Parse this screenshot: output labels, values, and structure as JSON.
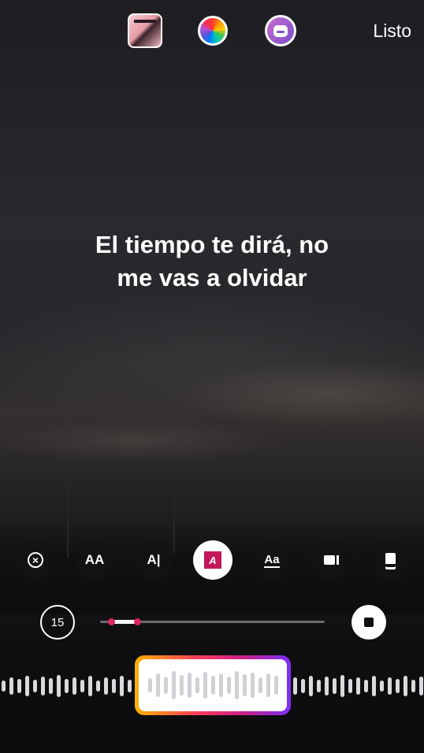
{
  "topbar": {
    "done_label": "Listo"
  },
  "lyrics": {
    "line1": "El tiempo te dirá, no",
    "line2": "me vas a olvidar"
  },
  "tools": [
    {
      "name": "close-style-button",
      "glyph": "⊗"
    },
    {
      "name": "text-size-button",
      "glyph": "AA"
    },
    {
      "name": "text-align-button",
      "glyph": "A|"
    },
    {
      "name": "highlight-style-button",
      "glyph": "A"
    },
    {
      "name": "underline-style-button",
      "glyph": "Aa"
    },
    {
      "name": "video-style-button",
      "glyph": "▮◀"
    },
    {
      "name": "card-style-button",
      "glyph": "▭"
    }
  ],
  "scrubber": {
    "duration_label": "15",
    "selection_start": 0.05,
    "selection_end": 0.165
  },
  "colors": {
    "accent": "#e0245e",
    "frame_gradient": [
      "#ffb200",
      "#ff3d5a",
      "#c81e8c",
      "#7b2ff7"
    ]
  }
}
